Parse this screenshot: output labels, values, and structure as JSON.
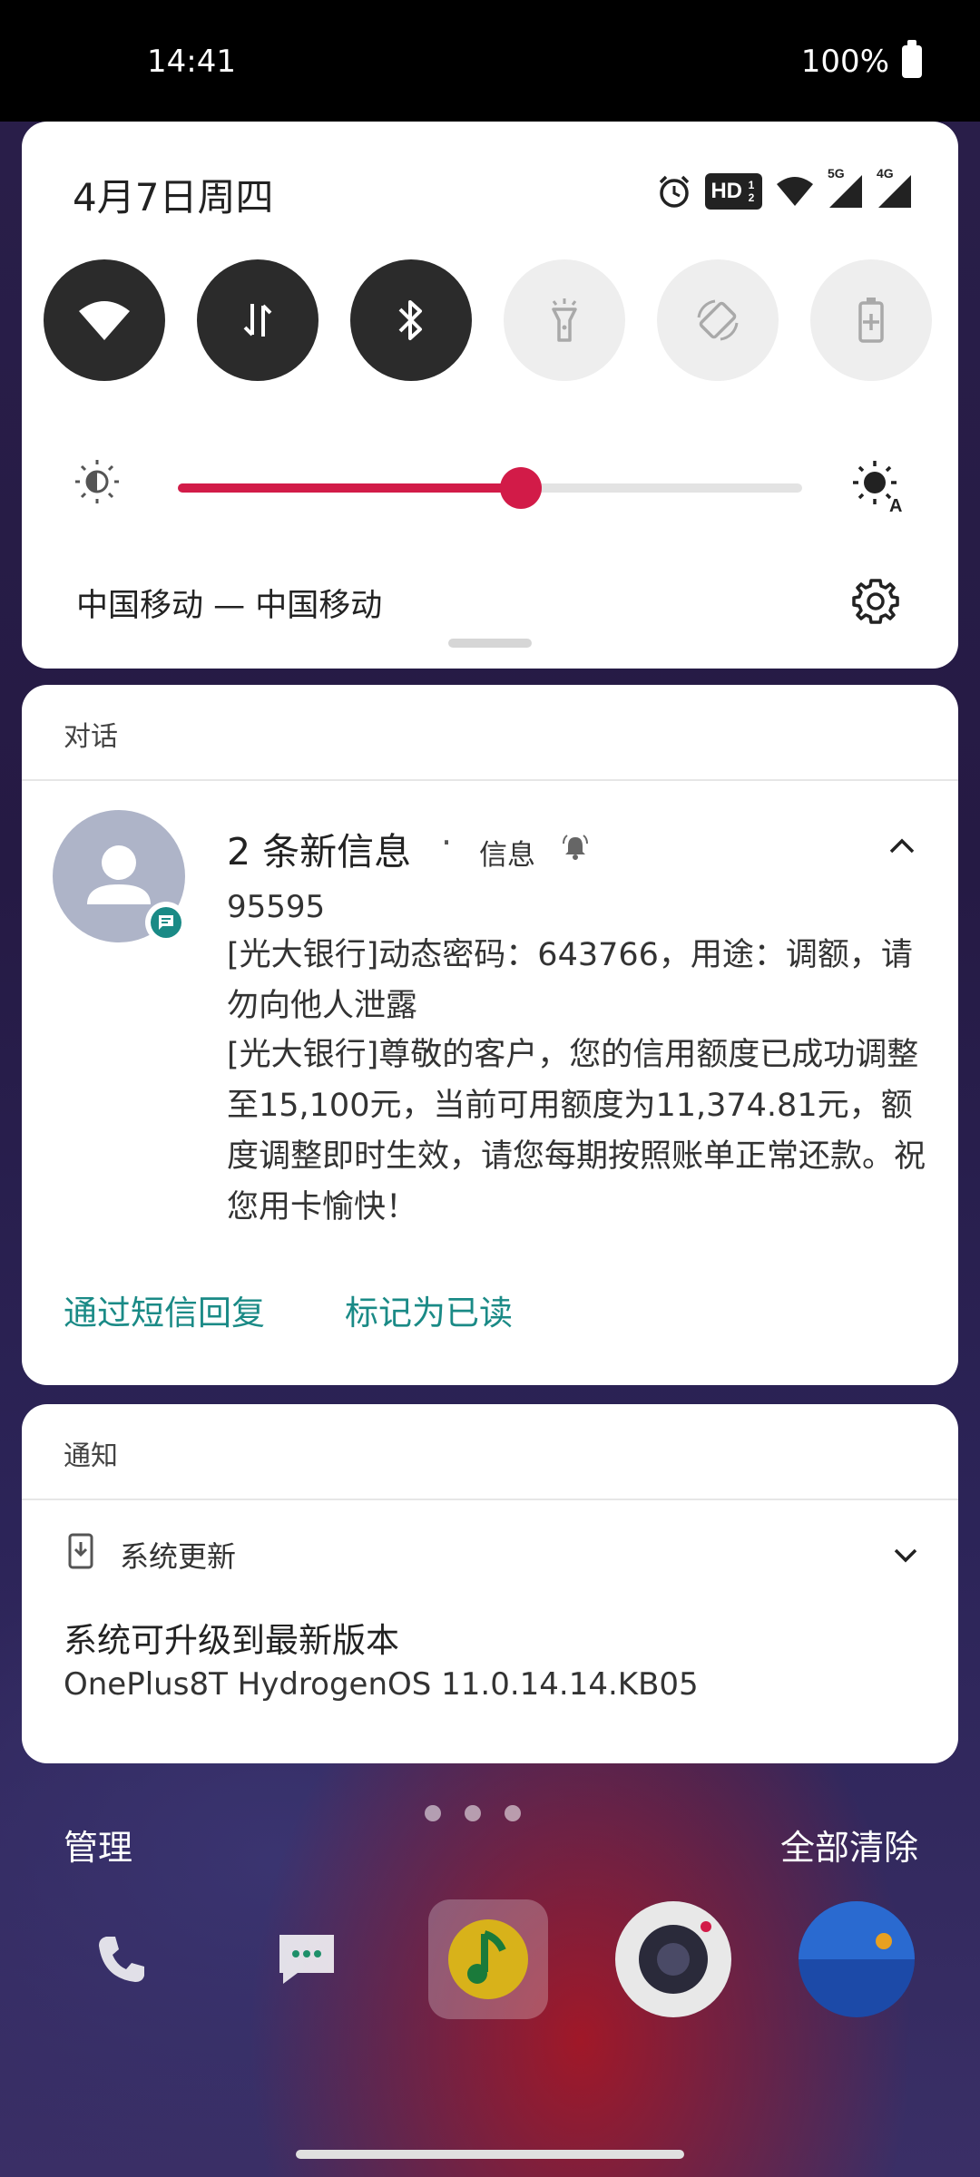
{
  "status_bar": {
    "time": "14:41",
    "battery": "100%"
  },
  "quick_settings": {
    "date": "4月7日周四",
    "toggles": [
      {
        "name": "wifi",
        "icon": "wifi-icon",
        "state": "on"
      },
      {
        "name": "mobile-data",
        "icon": "data-arrows-icon",
        "state": "on"
      },
      {
        "name": "bluetooth",
        "icon": "bluetooth-icon",
        "state": "on"
      },
      {
        "name": "flashlight",
        "icon": "flashlight-icon",
        "state": "off"
      },
      {
        "name": "auto-rotate",
        "icon": "rotate-icon",
        "state": "off"
      },
      {
        "name": "battery-saver",
        "icon": "battery-plus-icon",
        "state": "off"
      }
    ],
    "brightness_level": 0.55,
    "carrier": "中国移动 — 中国移动",
    "status_icons": {
      "hd_label": "HD",
      "hd_sub": "1 2",
      "net_5g": "5G",
      "net_4g": "4G"
    }
  },
  "conversation": {
    "section_label": "对话",
    "title": "2 条新信息",
    "separator": "·",
    "app_name": "信息",
    "sender": "95595",
    "messages": [
      "[光大银行]动态密码：643766，用途：调额，请勿向他人泄露",
      "[光大银行]尊敬的客户，您的信用额度已成功调整至15,100元，当前可用额度为11,374.81元，额度调整即时生效，请您每期按照账单正常还款。祝您用卡愉快！"
    ],
    "actions": {
      "reply": "通过短信回复",
      "mark_read": "标记为已读"
    },
    "accent_color": "#1a8a86"
  },
  "notifications": {
    "section_label": "通知",
    "app_name": "系统更新",
    "title": "系统可升级到最新版本",
    "body": "OnePlus8T HydrogenOS 11.0.14.14.KB05"
  },
  "shade_footer": {
    "manage": "管理",
    "clear_all": "全部清除"
  },
  "dock": [
    {
      "name": "phone",
      "icon": "phone-icon",
      "color": "#1b4fa0"
    },
    {
      "name": "messages",
      "icon": "chat-icon",
      "color": "#1e8f6a"
    },
    {
      "name": "music",
      "icon": "music-note-icon",
      "color": "#d8b21a"
    },
    {
      "name": "camera",
      "icon": "camera-icon",
      "color": "#e8e8e8"
    },
    {
      "name": "gallery",
      "icon": "gallery-icon",
      "color": "#1c4aa8"
    }
  ],
  "colors": {
    "brightness_accent": "#d21b48",
    "toggle_on": "#2b2b2b",
    "toggle_off": "#eeeeee"
  }
}
